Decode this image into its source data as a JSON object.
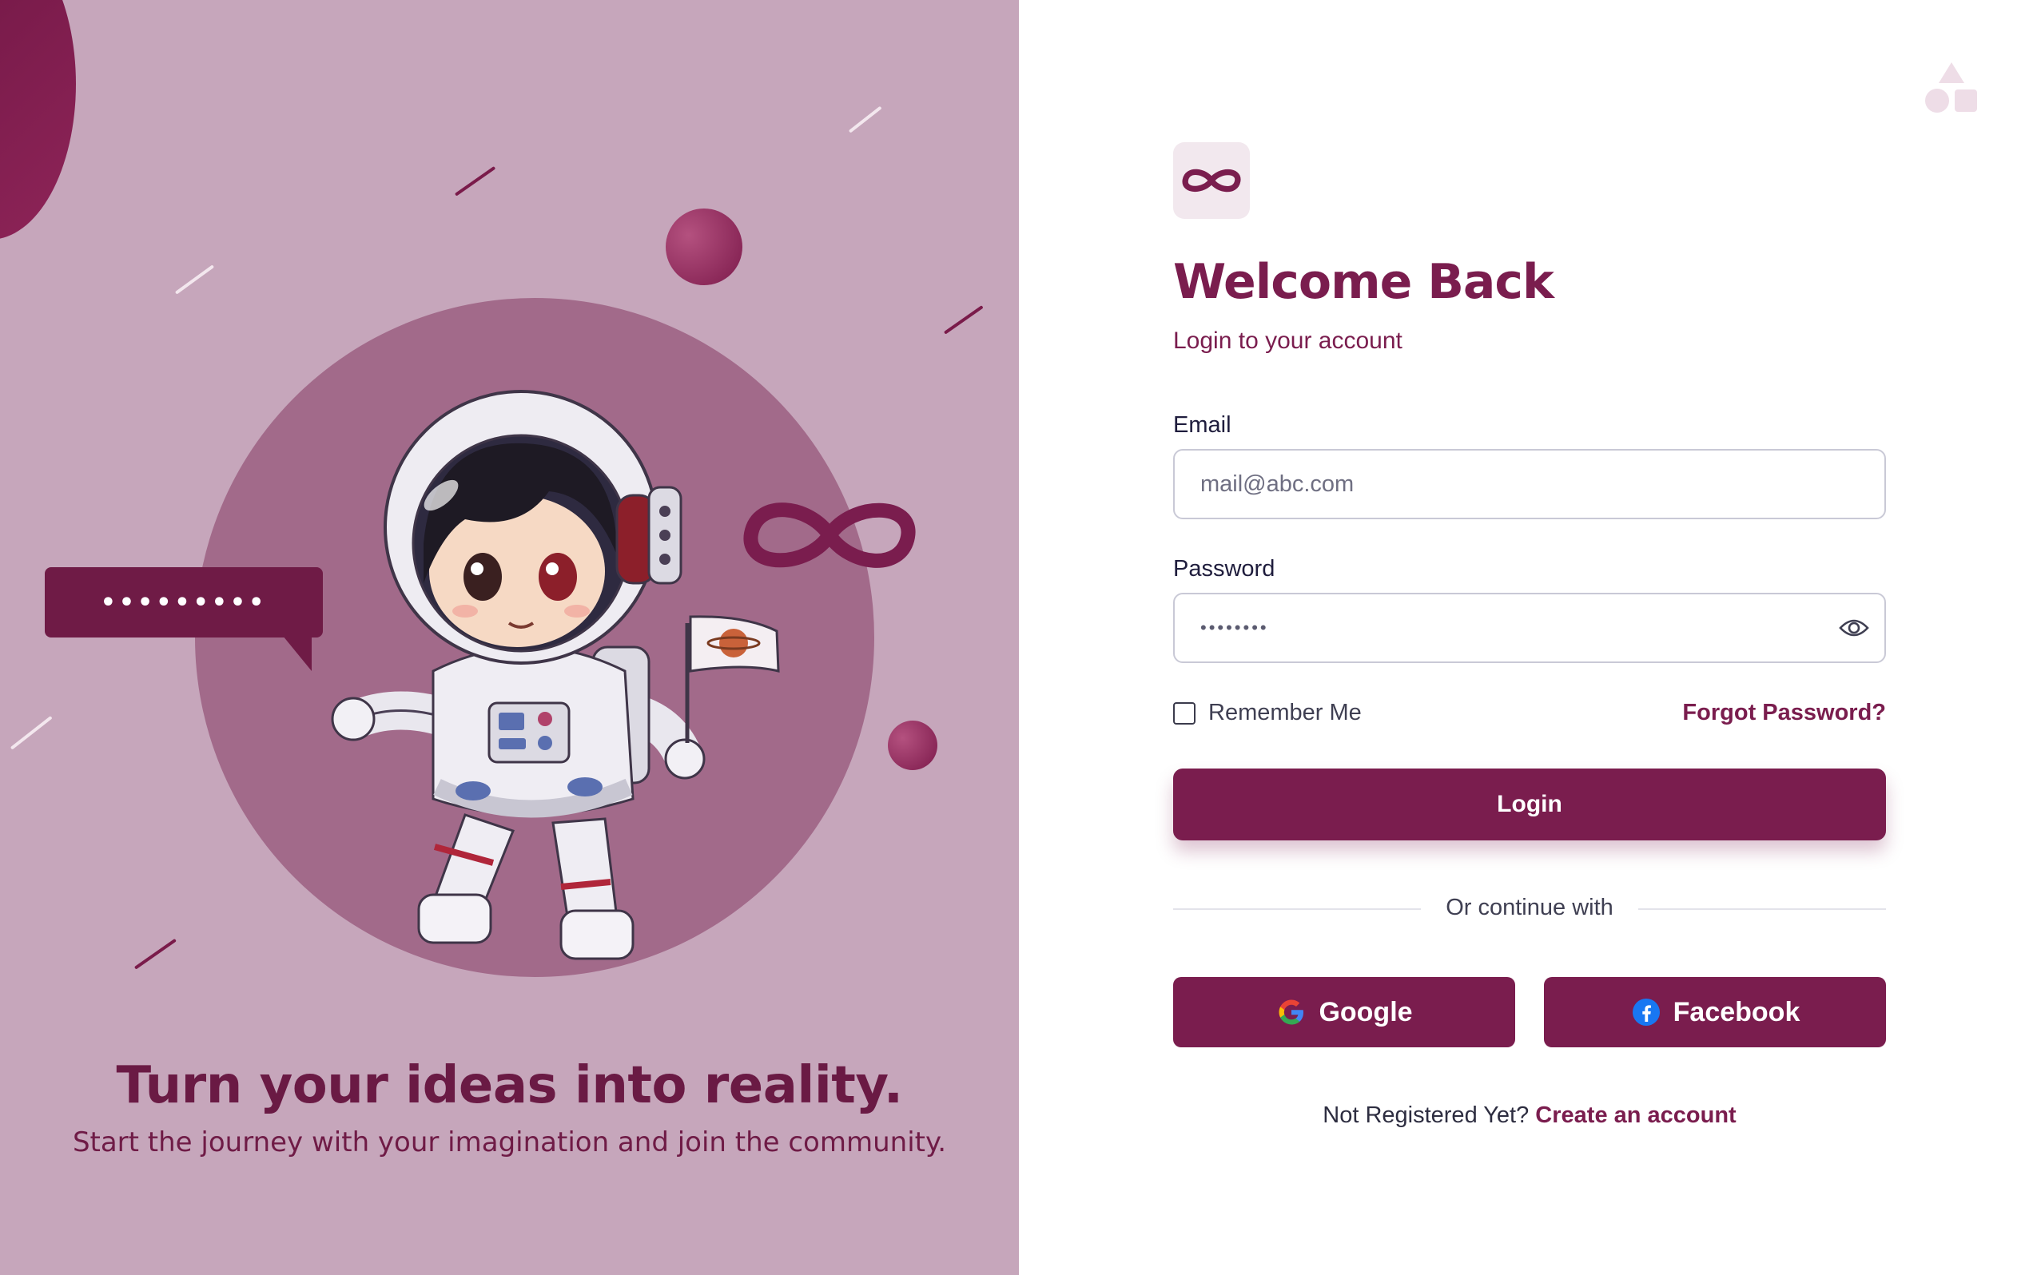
{
  "hero": {
    "bubble_text": "•••••••••",
    "title": "Turn your ideas into reality.",
    "subtitle": "Start the journey with your imagination and join the community."
  },
  "form": {
    "title": "Welcome Back",
    "subtitle": "Login to your account",
    "email": {
      "label": "Email",
      "placeholder": "mail@abc.com"
    },
    "password": {
      "label": "Password",
      "value": "••••••••"
    },
    "remember_label": "Remember Me",
    "remember_checked": false,
    "forgot_label": "Forgot Password?",
    "login_label": "Login",
    "divider_text": "Or continue with",
    "google_label": "Google",
    "facebook_label": "Facebook",
    "register_prompt": "Not Registered Yet?",
    "register_link": "Create an account"
  },
  "icons": {
    "brand": "infinity-icon",
    "password_toggle": "eye-icon",
    "google": "google-icon",
    "facebook": "facebook-icon",
    "decor": "shapes-icon"
  },
  "colors": {
    "primary": "#7a1d4e",
    "hero_bg": "#c6a6bb",
    "hero_circle": "#a26a8a",
    "text_dark": "#1f1d3d"
  }
}
